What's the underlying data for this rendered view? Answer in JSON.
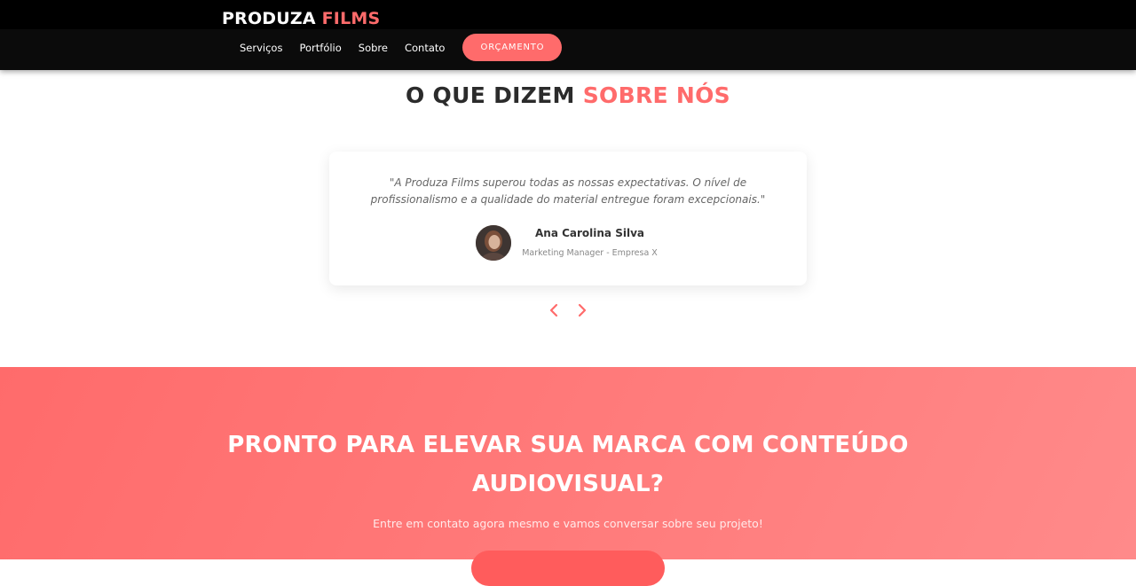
{
  "header": {
    "logo_main": "PRODUZA",
    "logo_accent": "FILMS",
    "nav": [
      {
        "label": "Serviços"
      },
      {
        "label": "Portfólio"
      },
      {
        "label": "Sobre"
      },
      {
        "label": "Contato"
      }
    ],
    "cta_label": "ORÇAMENTO"
  },
  "testimonials": {
    "title_main": "O QUE DIZEM",
    "title_accent": "SOBRE NÓS",
    "items": [
      {
        "quote": "\"A Produza Films superou todas as nossas expectativas. O nível de profissionalismo e a qualidade do material entregue foram excepcionais.\"",
        "author": "Ana Carolina Silva",
        "role": "Marketing Manager - Empresa X"
      }
    ],
    "prev_icon": "chevron-left-icon",
    "next_icon": "chevron-right-icon"
  },
  "cta": {
    "title": "PRONTO PARA ELEVAR SUA MARCA COM CONTEÚDO AUDIOVISUAL?",
    "subtitle": "Entre em contato agora mesmo e vamos conversar sobre seu projeto!"
  },
  "colors": {
    "accent": "#ff6b6b",
    "header_bg": "#0b0b0b",
    "text_dark": "#2b2b2b"
  }
}
